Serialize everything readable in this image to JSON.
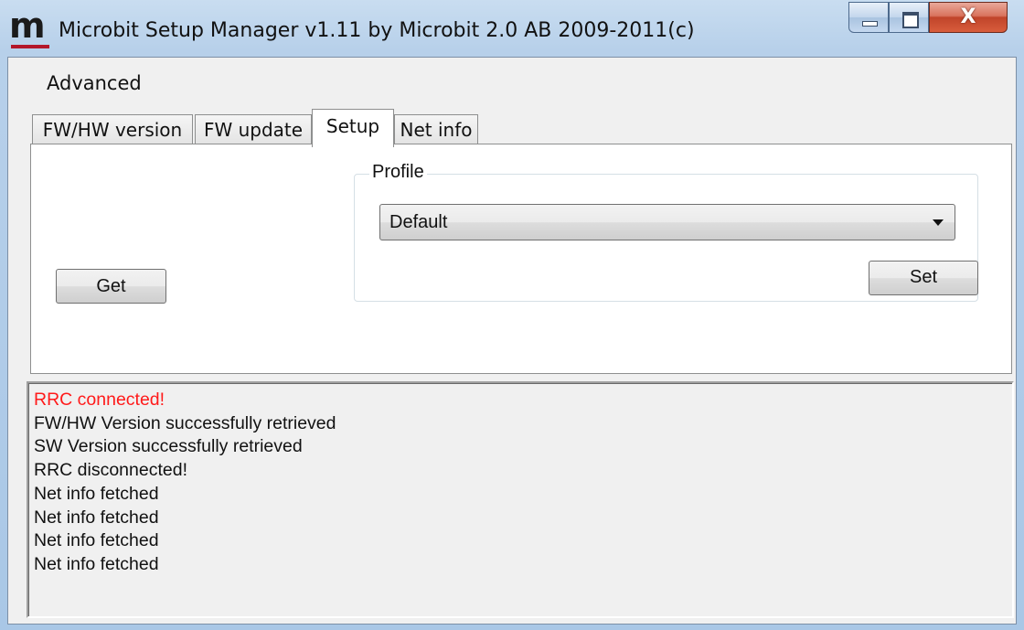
{
  "window": {
    "title": "Microbit Setup Manager v1.11 by Microbit 2.0 AB 2009-2011(c)",
    "logo_letter": "m",
    "logo_accent_color": "#b3162a",
    "close_glyph": "X"
  },
  "menu": {
    "items": [
      {
        "label": "Advanced"
      }
    ]
  },
  "tabs": [
    {
      "label": "FW/HW version",
      "active": false
    },
    {
      "label": "FW update",
      "active": false
    },
    {
      "label": "Setup",
      "active": true
    },
    {
      "label": "Net info",
      "active": false
    }
  ],
  "setup": {
    "get_label": "Get",
    "profile_group_label": "Profile",
    "profile_selected": "Default",
    "set_label": "Set"
  },
  "log": {
    "lines": [
      {
        "text": "RRC connected!",
        "color": "#ff1a1a"
      },
      {
        "text": "FW/HW Version successfully retrieved"
      },
      {
        "text": "SW Version successfully retrieved"
      },
      {
        "text": "RRC disconnected!"
      },
      {
        "text": "Net info fetched"
      },
      {
        "text": "Net info fetched"
      },
      {
        "text": "Net info fetched"
      },
      {
        "text": "Net info fetched"
      }
    ]
  }
}
